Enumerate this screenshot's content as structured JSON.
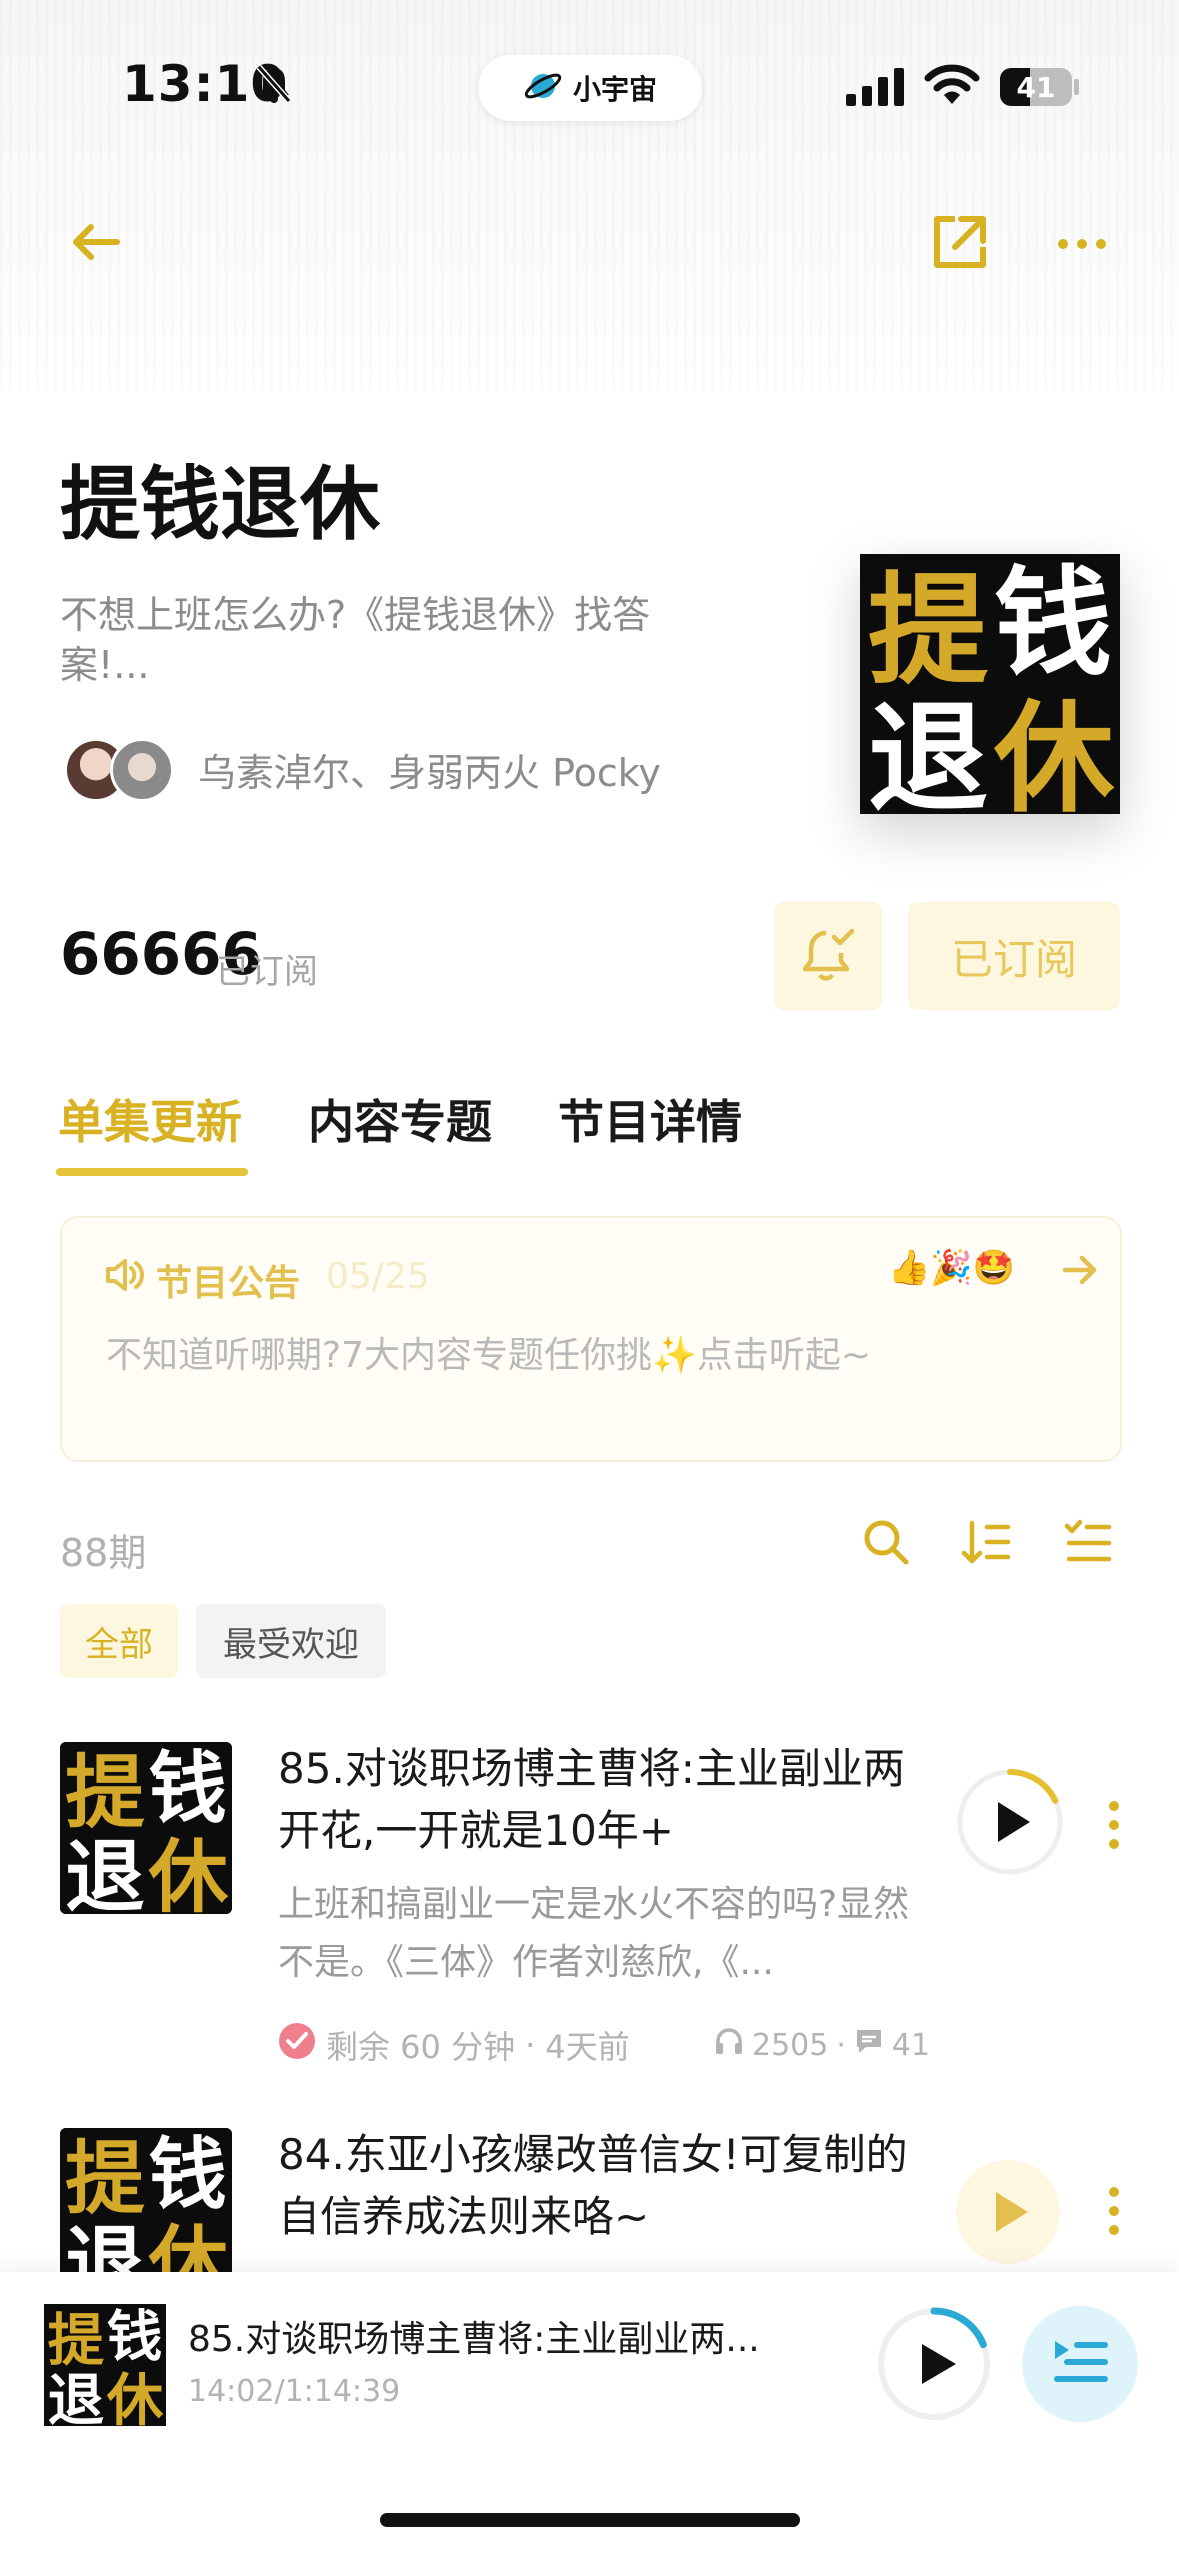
{
  "status_bar": {
    "time": "13:10",
    "brand": "小宇宙",
    "battery": "41"
  },
  "podcast": {
    "title": "提钱退休",
    "description": "不想上班怎么办?《提钱退休》找答案!...",
    "hosts": "乌素淖尔、身弱丙火 Pocky",
    "cover_text": [
      "提",
      "钱",
      "退",
      "休"
    ],
    "subscribers": "66666",
    "subscribers_label": "已订阅",
    "subscribe_button": "已订阅"
  },
  "tabs": [
    {
      "label": "单集更新",
      "active": true
    },
    {
      "label": "内容专题",
      "active": false
    },
    {
      "label": "节目详情",
      "active": false
    }
  ],
  "announcement": {
    "title": "节目公告",
    "date": "05/25",
    "text": "不知道听哪期?7大内容专题任你挑✨点击听起~",
    "emojis": "👍🎉🤩"
  },
  "list": {
    "count": "88期",
    "filters": [
      "全部",
      "最受欢迎"
    ]
  },
  "episodes": [
    {
      "title": "85.对谈职场博主曹将:主业副业两开花,一开就是10年+",
      "summary": "上班和搞副业一定是水火不容的吗?显然不是。《三体》作者刘慈欣,《...",
      "remaining": "剩余 60 分钟",
      "age": "4天前",
      "plays": "2505",
      "comments": "41",
      "progress": 0.18
    },
    {
      "title": "84.东亚小孩爆改普信女!可复制的自信养成法则来咯~",
      "summary": "",
      "progress": 0
    }
  ],
  "now_playing": {
    "title": "85.对谈职场博主曹将:主业副业两...",
    "time": "14:02/1:14:39",
    "progress": 0.19
  },
  "colors": {
    "accent": "#e4c53a",
    "accent_text": "#d9b224",
    "accent_bg": "#fdf7e0",
    "cover_bg": "#0c0c0c",
    "queue_bg": "#dff3fb",
    "queue_icon": "#2aa9d6"
  }
}
